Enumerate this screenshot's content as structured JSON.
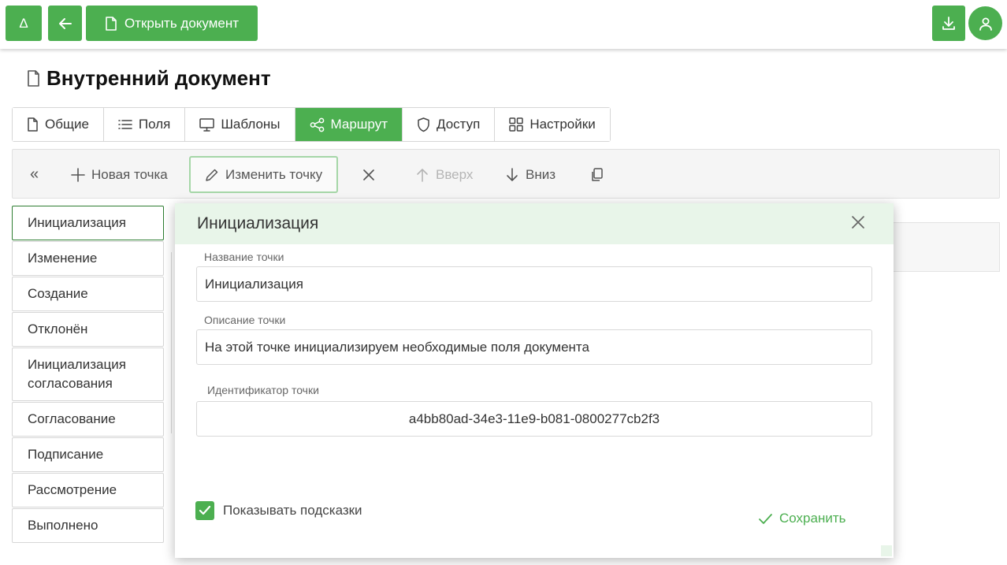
{
  "topbar": {
    "delta_label": "Δ",
    "open_doc_label": "Открыть документ",
    "icons": {
      "back": "arrow-left-icon",
      "doc": "document-icon",
      "download": "download-icon",
      "user": "user-icon"
    }
  },
  "page": {
    "title": "Внутренний документ"
  },
  "tabs": [
    {
      "label": "Общие",
      "icon": "document-icon"
    },
    {
      "label": "Поля",
      "icon": "list-icon"
    },
    {
      "label": "Шаблоны",
      "icon": "monitor-icon"
    },
    {
      "label": "Маршрут",
      "icon": "share-icon",
      "active": true
    },
    {
      "label": "Доступ",
      "icon": "shield-icon"
    },
    {
      "label": "Настройки",
      "icon": "grid-icon"
    }
  ],
  "toolbar": {
    "collapse_label": "«",
    "new_point_label": "Новая точка",
    "edit_point_label": "Изменить точку",
    "up_label": "Вверх",
    "down_label": "Вниз"
  },
  "points": [
    "Инициализация",
    "Изменение",
    "Создание",
    "Отклонён",
    "Инициализация согласования",
    "Согласование",
    "Подписание",
    "Рассмотрение",
    "Выполнено"
  ],
  "modal": {
    "title": "Инициализация",
    "name_label": "Название точки",
    "name_value": "Инициализация",
    "desc_label": "Описание точки",
    "desc_value": "На этой точке инициализируем необходимые поля документа",
    "id_label": "Идентификатор точки",
    "id_value": "a4bb80ad-34e3-11e9-b081-0800277cb2f3",
    "show_hints_label": "Показывать подсказки",
    "show_hints_checked": true,
    "save_label": "Сохранить"
  },
  "colors": {
    "accent": "#4caf50",
    "header_tint": "#e8f5e9"
  }
}
